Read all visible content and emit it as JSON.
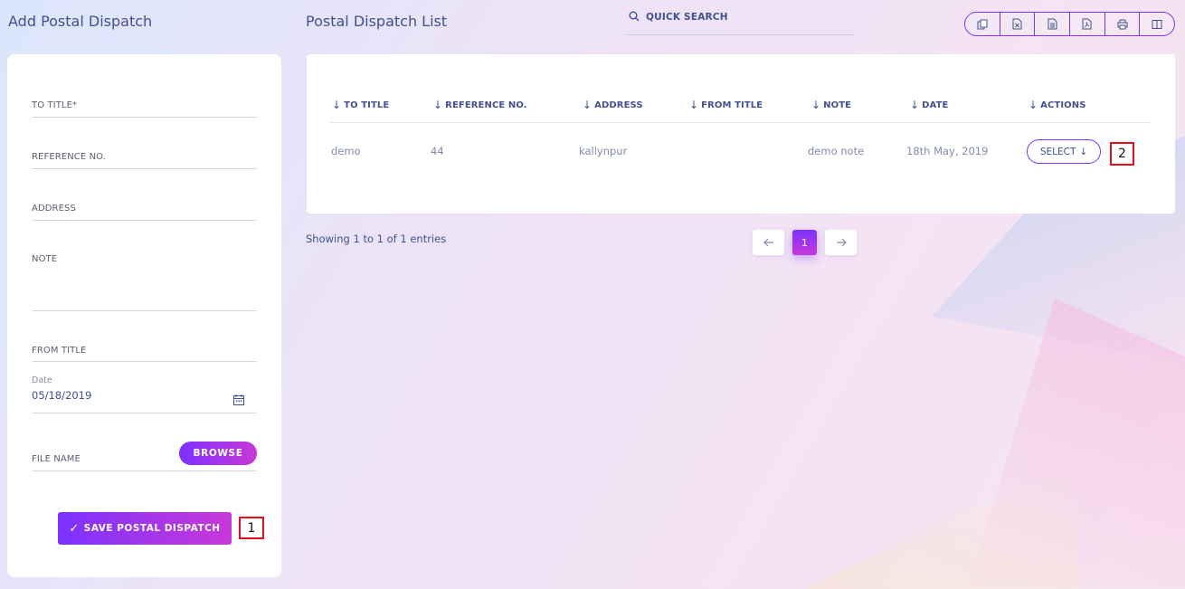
{
  "left_panel": {
    "title": "Add Postal Dispatch",
    "fields": {
      "to_title": "TO TITLE*",
      "reference_no": "REFERENCE NO.",
      "address": "ADDRESS",
      "note": "NOTE",
      "from_title": "FROM TITLE",
      "date_label": "Date",
      "date_value": "05/18/2019",
      "file_name": "FILE NAME"
    },
    "browse_label": "BROWSE",
    "save_label": "SAVE POSTAL DISPATCH",
    "marker": "1"
  },
  "right_panel": {
    "title": "Postal Dispatch List",
    "search_label": "QUICK SEARCH",
    "toolbar_icons": [
      "copy-icon",
      "excel-icon",
      "csv-icon",
      "pdf-icon",
      "print-icon",
      "columns-icon"
    ],
    "columns": [
      "TO TITLE",
      "REFERENCE NO.",
      "ADDRESS",
      "FROM TITLE",
      "NOTE",
      "DATE",
      "ACTIONS"
    ],
    "rows": [
      {
        "to_title": "demo",
        "reference_no": "44",
        "address": "kallynpur",
        "from_title": "",
        "note": "demo note",
        "date": "18th May, 2019",
        "action_label": "SELECT"
      }
    ],
    "marker": "2",
    "showing_text": "Showing 1 to 1 of 1 entries",
    "pagination": {
      "current": "1",
      "prev_icon": "arrow-left-icon",
      "next_icon": "arrow-right-icon"
    }
  },
  "colors": {
    "accent": "#7c32ff",
    "accent2": "#c738d8",
    "text": "#415094",
    "muted": "#828bb2",
    "marker": "#e0101a"
  }
}
